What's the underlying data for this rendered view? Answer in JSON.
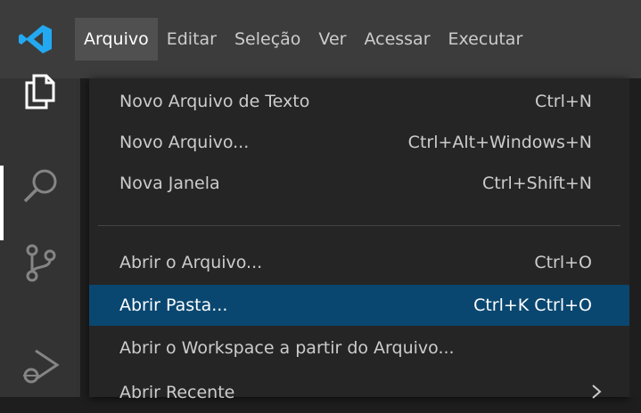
{
  "menubar": {
    "items": [
      {
        "label": "Arquivo",
        "active": true
      },
      {
        "label": "Editar"
      },
      {
        "label": "Seleção"
      },
      {
        "label": "Ver"
      },
      {
        "label": "Acessar"
      },
      {
        "label": "Executar"
      }
    ]
  },
  "activitybar": {
    "icons": [
      "explorer-icon",
      "search-icon",
      "source-control-icon",
      "run-debug-icon"
    ]
  },
  "file_menu": {
    "items": [
      {
        "label": "Novo Arquivo de Texto",
        "shortcut": "Ctrl+N"
      },
      {
        "label": "Novo Arquivo...",
        "shortcut": "Ctrl+Alt+Windows+N"
      },
      {
        "label": "Nova Janela",
        "shortcut": "Ctrl+Shift+N"
      },
      {
        "label": "Abrir o Arquivo...",
        "shortcut": "Ctrl+O"
      },
      {
        "label": "Abrir Pasta...",
        "shortcut": "Ctrl+K Ctrl+O",
        "selected": true
      },
      {
        "label": "Abrir o Workspace a partir do Arquivo...",
        "shortcut": ""
      },
      {
        "label": "Abrir Recente",
        "shortcut": "",
        "submenu": true
      }
    ]
  },
  "colors": {
    "titlebar": "#3c3c3c",
    "activitybar": "#333333",
    "menu_bg": "#252526",
    "selection": "#094771",
    "vscode_blue": "#23a9f2"
  }
}
